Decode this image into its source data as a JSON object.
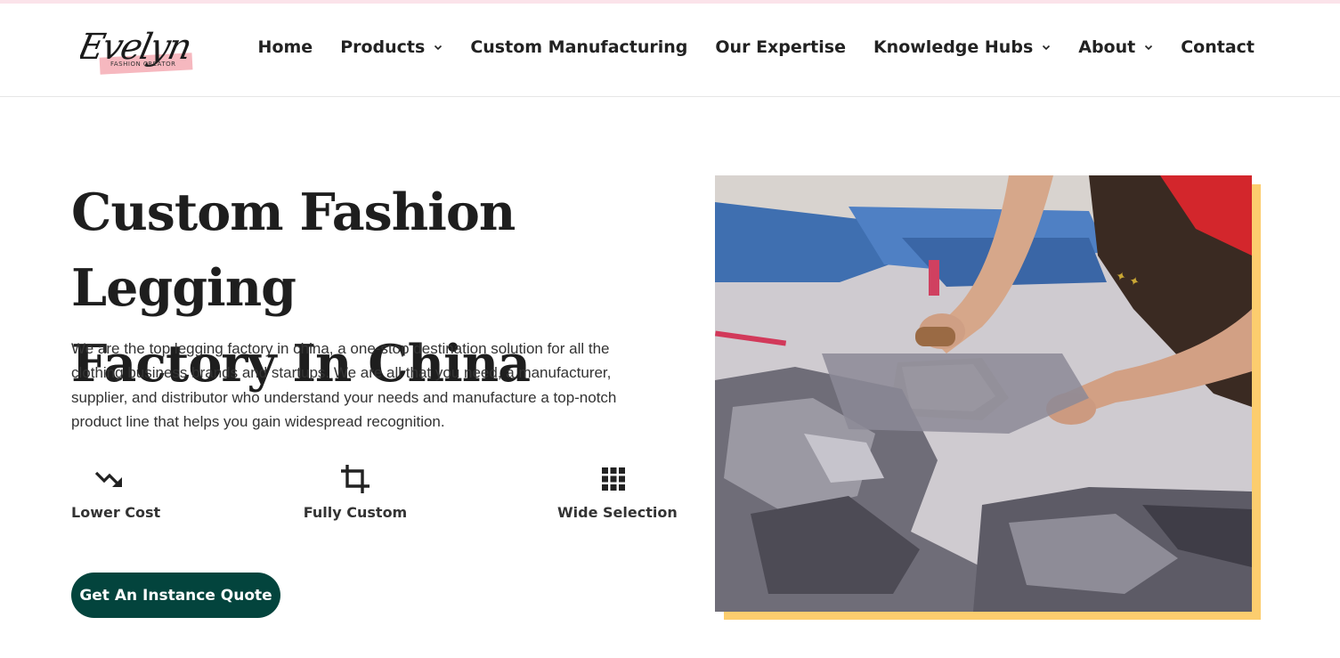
{
  "brand": {
    "logo_script": "Evelyn",
    "logo_tagline": "FASHION CREATOR"
  },
  "nav": {
    "items": [
      {
        "label": "Home",
        "dropdown": false
      },
      {
        "label": "Products",
        "dropdown": true
      },
      {
        "label": "Custom Manufacturing",
        "dropdown": false
      },
      {
        "label": "Our Expertise",
        "dropdown": false
      },
      {
        "label": "Knowledge Hubs",
        "dropdown": true
      },
      {
        "label": "About",
        "dropdown": true
      },
      {
        "label": "Contact",
        "dropdown": false
      }
    ]
  },
  "hero": {
    "title_line1": "Custom Fashion Legging",
    "title_line2": "Factory In China",
    "description": "We are the top legging factory in china, a one-stop destination solution for all the clothing business brands and startups. We are all that you need, a manufacturer, supplier, and distributor who understand your needs and manufacture a top-notch product line that helps you gain widespread recognition.",
    "features": [
      {
        "label": "Lower Cost",
        "icon": "trending-down-icon"
      },
      {
        "label": "Fully Custom",
        "icon": "crop-icon"
      },
      {
        "label": "Wide Selection",
        "icon": "grid-icon"
      }
    ],
    "cta_label": "Get An Instance Quote"
  },
  "colors": {
    "accent_dark_green": "#03443d",
    "photo_frame_yellow": "#fccd6e",
    "logo_highlight_pink": "#f6b8bf",
    "text_dark": "#1e1e1e"
  }
}
